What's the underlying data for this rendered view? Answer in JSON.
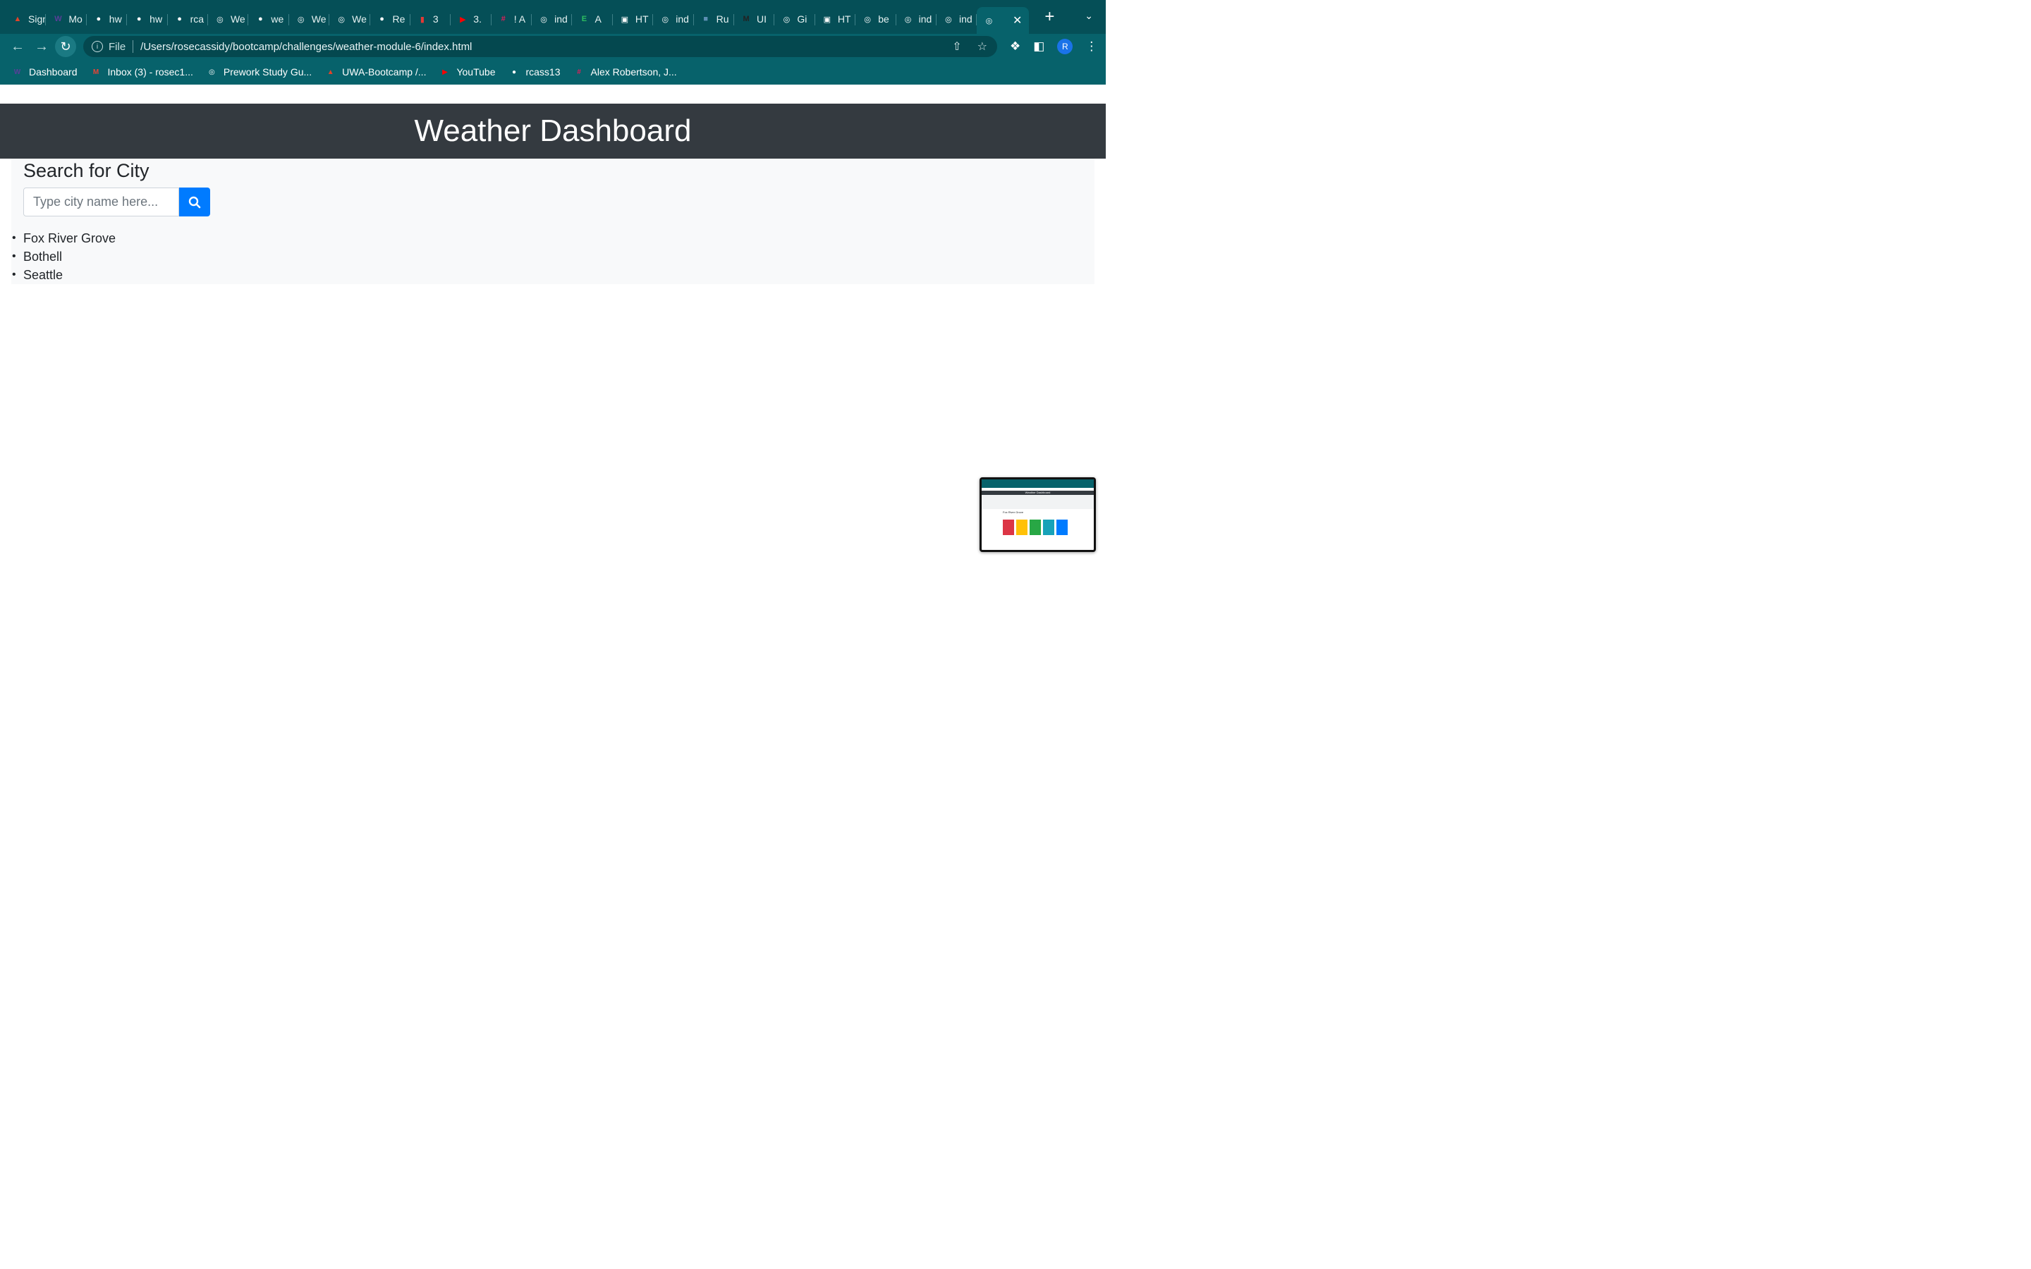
{
  "browser": {
    "tabs": [
      {
        "label": "Sign",
        "icon": "gitlab-icon",
        "color": "#e24329"
      },
      {
        "label": "Mo",
        "icon": "w-icon",
        "color": "#5a3e99"
      },
      {
        "label": "hw",
        "icon": "github-icon",
        "color": "#ffffff"
      },
      {
        "label": "hw",
        "icon": "github-icon",
        "color": "#ffffff"
      },
      {
        "label": "rca",
        "icon": "github-icon",
        "color": "#ffffff"
      },
      {
        "label": "We",
        "icon": "globe-icon",
        "color": "#ffffff"
      },
      {
        "label": "we",
        "icon": "github-icon",
        "color": "#ffffff"
      },
      {
        "label": "We",
        "icon": "globe-icon",
        "color": "#ffffff"
      },
      {
        "label": "We",
        "icon": "globe-icon",
        "color": "#ffffff"
      },
      {
        "label": "Re",
        "icon": "github-icon",
        "color": "#ffffff"
      },
      {
        "label": "3",
        "icon": "rocket-icon",
        "color": "#e53935"
      },
      {
        "label": "3.",
        "icon": "youtube-icon",
        "color": "#ff0000"
      },
      {
        "label": "! A",
        "icon": "slack-icon",
        "color": "#e01e5a"
      },
      {
        "label": "ind",
        "icon": "globe-icon",
        "color": "#ffffff"
      },
      {
        "label": "A",
        "icon": "evernote-icon",
        "color": "#2dbe60"
      },
      {
        "label": "HT",
        "icon": "image-icon",
        "color": "#ffffff"
      },
      {
        "label": "ind",
        "icon": "globe-icon",
        "color": "#ffffff"
      },
      {
        "label": "Ru",
        "icon": "photo-icon",
        "color": "#5c8fb3"
      },
      {
        "label": "UI",
        "icon": "m-icon",
        "color": "#222222"
      },
      {
        "label": "Gi",
        "icon": "globe-icon",
        "color": "#ffffff"
      },
      {
        "label": "HT",
        "icon": "image-icon",
        "color": "#ffffff"
      },
      {
        "label": "be",
        "icon": "globe-icon",
        "color": "#ffffff"
      },
      {
        "label": "ind",
        "icon": "globe-icon",
        "color": "#ffffff"
      },
      {
        "label": "ind",
        "icon": "globe-icon",
        "color": "#ffffff"
      }
    ],
    "active_tab_icon": "globe-icon",
    "address": {
      "scheme": "File",
      "url": "/Users/rosecassidy/bootcamp/challenges/weather-module-6/index.html"
    },
    "profile_initial": "R",
    "bookmarks": [
      {
        "label": "Dashboard",
        "icon": "w-icon",
        "color": "#5a3e99"
      },
      {
        "label": "Inbox (3) - rosec1...",
        "icon": "gmail-icon",
        "color": "#ea4335"
      },
      {
        "label": "Prework Study Gu...",
        "icon": "globe-icon",
        "color": "#ffffff"
      },
      {
        "label": "UWA-Bootcamp /...",
        "icon": "gitlab-icon",
        "color": "#e24329"
      },
      {
        "label": "YouTube",
        "icon": "youtube-icon",
        "color": "#ff0000"
      },
      {
        "label": "rcass13",
        "icon": "github-icon",
        "color": "#ffffff"
      },
      {
        "label": "Alex Robertson, J...",
        "icon": "slack-icon",
        "color": "#e01e5a"
      }
    ]
  },
  "page": {
    "title": "Weather Dashboard",
    "search": {
      "heading": "Search for City",
      "placeholder": "Type city name here...",
      "button_icon": "search-icon"
    },
    "history": [
      "Fox River Grove",
      "Bothell",
      "Seattle"
    ]
  },
  "thumbnail": {
    "title": "Weather Dashboard",
    "city": "Fox River Grove",
    "card_colors": [
      "#dc3545",
      "#ffc107",
      "#28a745",
      "#17a2b8",
      "#007bff"
    ]
  },
  "colors": {
    "header_bg": "#343a40",
    "accent": "#007bff",
    "chrome": "#07626b"
  }
}
